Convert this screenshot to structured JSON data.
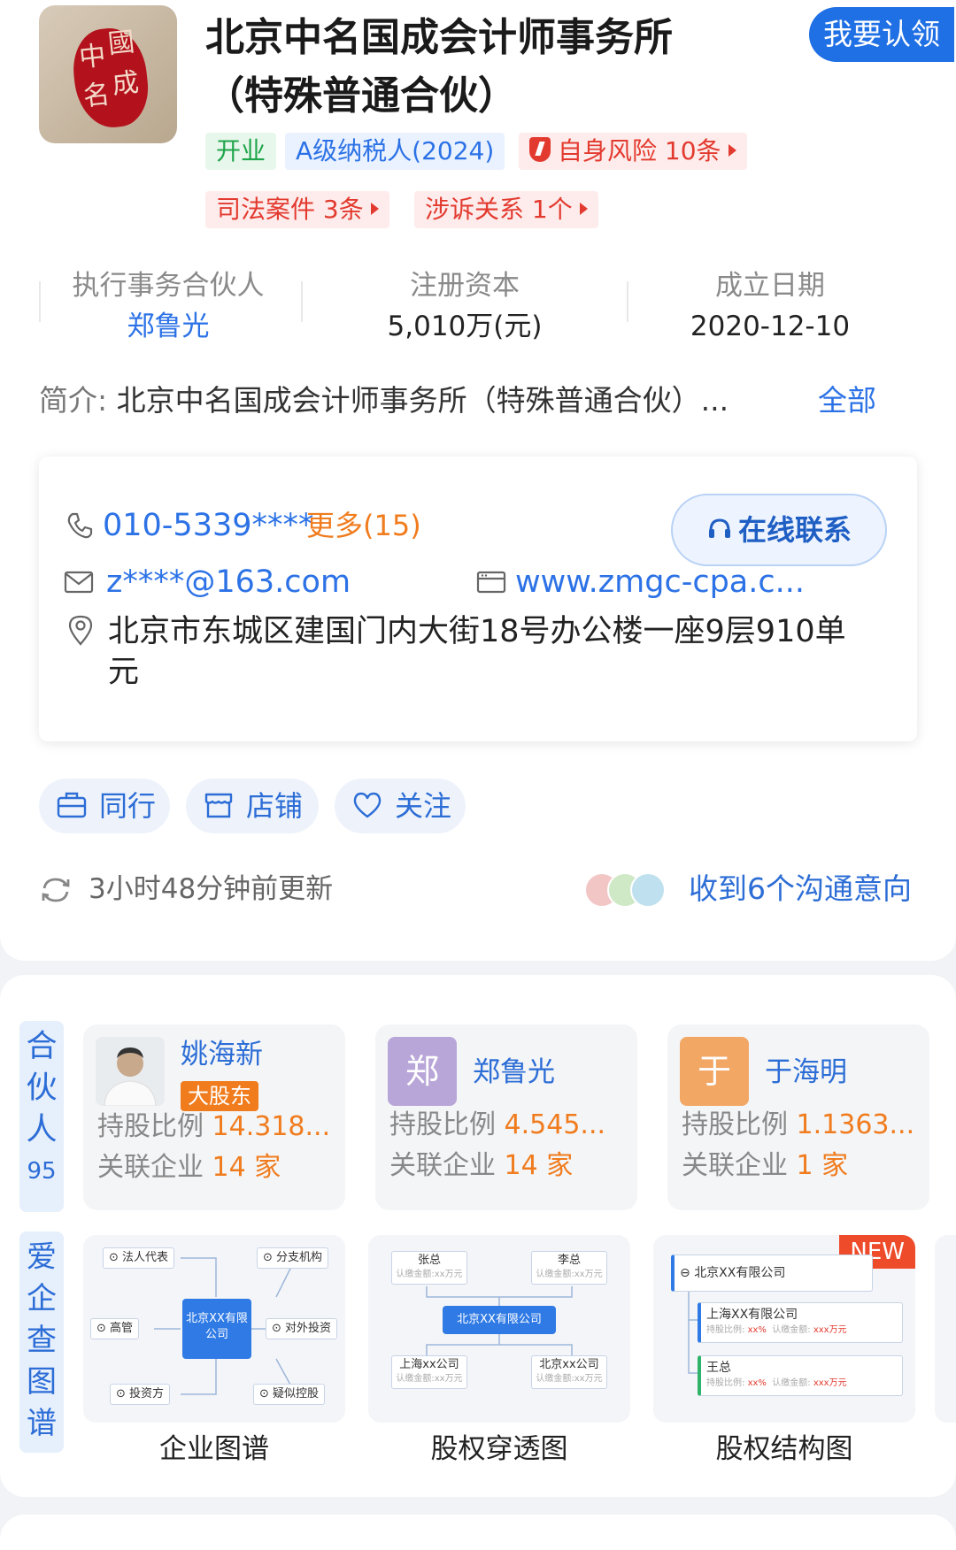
{
  "company": {
    "name_line1": "北京中名国成会计师事务所",
    "name_line2": "（特殊普通合伙）",
    "logo_alt": "中名國成"
  },
  "claim_button": "我要认领",
  "tags": {
    "status": "开业",
    "tax": "A级纳税人(2024)",
    "risk": "自身风险 10条",
    "judicial": "司法案件 3条",
    "litigation": "涉诉关系 1个"
  },
  "stats": {
    "partner_label": "执行事务合伙人",
    "partner_value": "郑鲁光",
    "capital_label": "注册资本",
    "capital_value": "5,010万(元)",
    "date_label": "成立日期",
    "date_value": "2020-12-10"
  },
  "intro": {
    "label": "简介:",
    "text": "北京中名国成会计师事务所（特殊普通合伙）...",
    "more": "全部"
  },
  "contact": {
    "phone": "010-5339****",
    "phone_more": "更多(15)",
    "online": "在线联系",
    "email": "z****@163.com",
    "website": "www.zmgc-cpa.c...",
    "address_line1": "北京市东城区建国门内大街18号办公楼一座9层910单",
    "address_line2": "元"
  },
  "actions": {
    "peers": "同行",
    "shop": "店铺",
    "follow": "关注"
  },
  "update_text": "3小时48分钟前更新",
  "intent_text": "收到6个沟通意向",
  "partners_section": {
    "label_chars": [
      "合",
      "伙",
      "人"
    ],
    "count": "95",
    "items": [
      {
        "name": "姚海新",
        "badge": "大股东",
        "ratio_label": "持股比例",
        "ratio": "14.318...",
        "related_label": "关联企业",
        "related": "14 家"
      },
      {
        "name": "郑鲁光",
        "avatar_char": "郑",
        "ratio_label": "持股比例",
        "ratio": "4.545...",
        "related_label": "关联企业",
        "related": "14 家"
      },
      {
        "name": "于海明",
        "avatar_char": "于",
        "ratio_label": "持股比例",
        "ratio": "1.1363...",
        "related_label": "关联企业",
        "related": "1 家"
      }
    ]
  },
  "graph_section": {
    "label_chars": [
      "爱",
      "企",
      "查",
      "图",
      "谱"
    ],
    "items": [
      {
        "title": "企业图谱",
        "center": "北京XX有限公司",
        "nodes": [
          "法人代表",
          "分支机构",
          "高管",
          "对外投资",
          "投资方",
          "疑似控股"
        ]
      },
      {
        "title": "股权穿透图",
        "center": "北京XX有限公司",
        "top_nodes": [
          {
            "name": "张总",
            "sub": "认缴金额:xx万元"
          },
          {
            "name": "李总",
            "sub": "认缴金额:xx万元"
          }
        ],
        "bottom_nodes": [
          {
            "name": "上海xx公司",
            "sub": "认缴金额:xx万元"
          },
          {
            "name": "北京xx公司",
            "sub": "认缴金额:xx万元"
          }
        ]
      },
      {
        "title": "股权结构图",
        "badge": "NEW",
        "root": "北京XX有限公司",
        "children": [
          {
            "name": "上海XX有限公司",
            "sub1": "持股比例: ",
            "sub1v": "xx%",
            "sub2": "认缴金额: ",
            "sub2v": "xxx万元"
          },
          {
            "name": "王总",
            "sub1": "持股比例: ",
            "sub1v": "xx%",
            "sub2": "认缴金额: ",
            "sub2v": "xxx万元"
          }
        ]
      }
    ]
  },
  "colors": {
    "brand_blue": "#2c72e6",
    "risk_red": "#e33a2f",
    "status_green": "#1fa54a",
    "accent_orange": "#f07c1e"
  },
  "icons": [
    "phone-icon",
    "email-icon",
    "website-icon",
    "location-icon",
    "headset-icon",
    "briefcase-icon",
    "shop-icon",
    "heart-icon",
    "refresh-icon",
    "shield-icon"
  ]
}
